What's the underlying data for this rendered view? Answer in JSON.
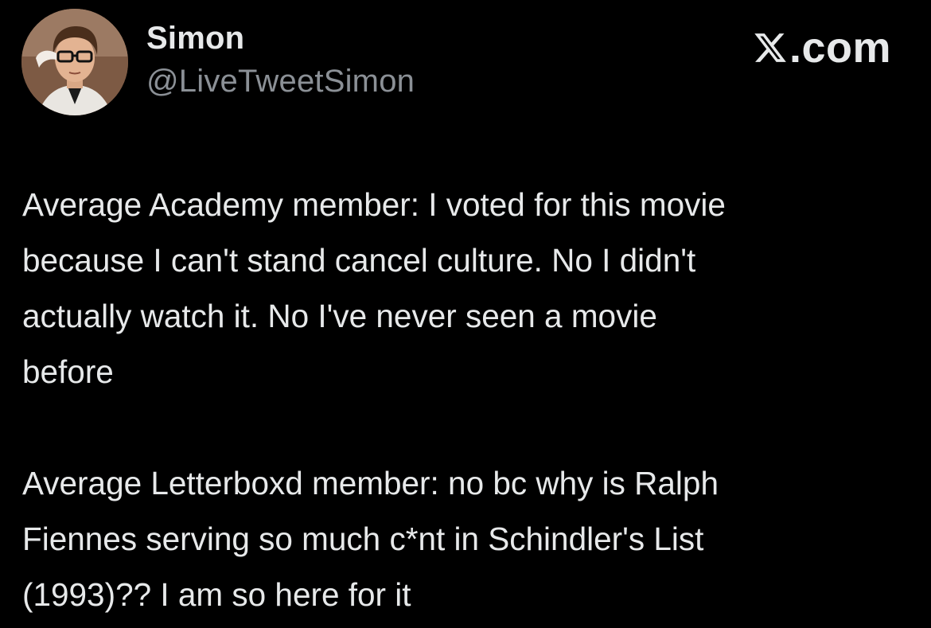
{
  "author": {
    "display_name": "Simon",
    "handle": "@LiveTweetSimon",
    "avatar_icon": "profile-photo"
  },
  "brand": {
    "logo_icon": "x-logo-icon",
    "text": ".com"
  },
  "tweet": {
    "paragraphs": [
      "Average Academy member: I voted for this movie\nbecause I can't stand cancel culture. No I didn't\nactually watch it. No I've never seen a movie\nbefore",
      "Average Letterboxd member: no bc why is Ralph\nFiennes serving so much c*nt in Schindler's List\n(1993)?? I am so here for it"
    ]
  },
  "colors": {
    "background": "#000000",
    "primary_text": "#e7e9ea",
    "secondary_text": "#8b9096"
  }
}
